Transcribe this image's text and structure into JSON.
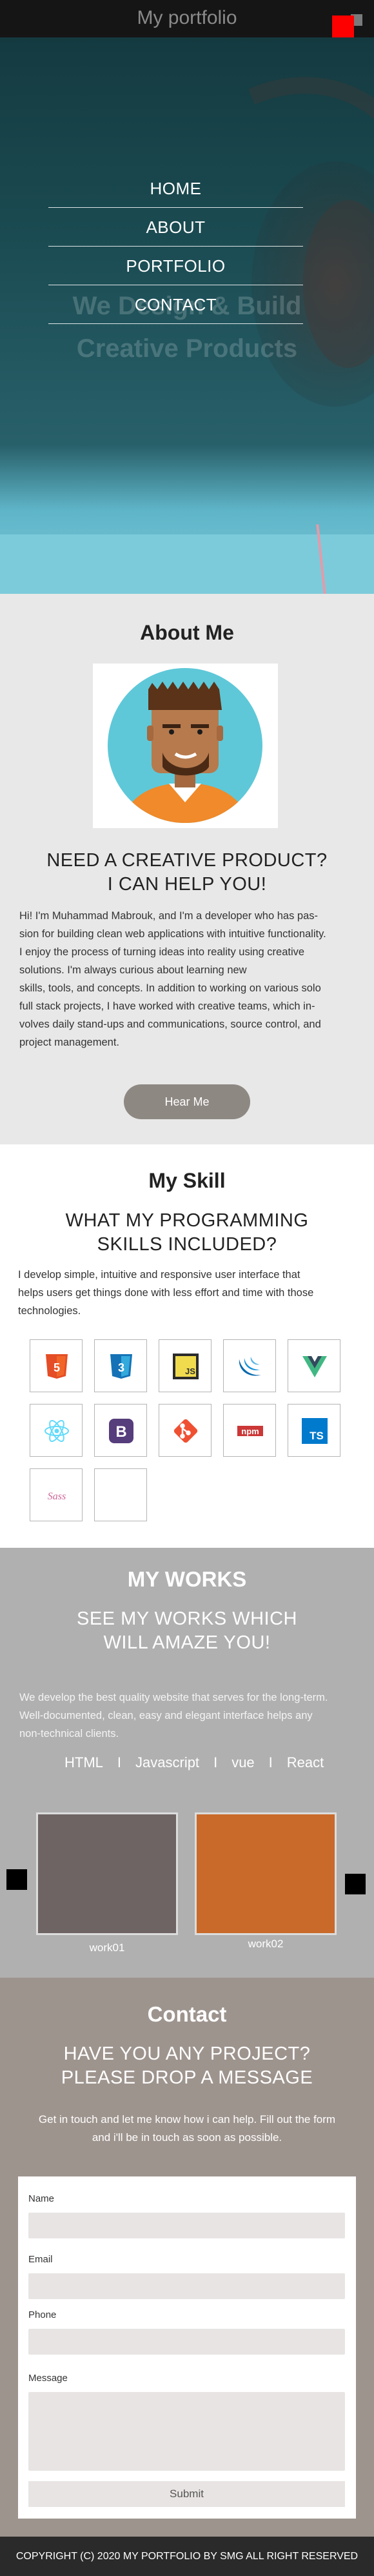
{
  "header": {
    "brand": "My portfolio",
    "nav": [
      {
        "label": "HOME"
      },
      {
        "label": "ABOUT"
      },
      {
        "label": "PORTFOLIO"
      },
      {
        "label": "CONTACT"
      }
    ],
    "hero_line1": "We Design & Build",
    "hero_line2": "Creative Products"
  },
  "about": {
    "title": "About Me",
    "subtitle_line1": "NEED A CREATIVE PRODUCT?",
    "subtitle_line2": "I CAN HELP YOU!",
    "body_lines": [
      "Hi! I'm Muhammad Mabrouk, and I'm a developer who has pas-",
      "sion for building clean web applications with intuitive functionality.",
      "I enjoy the process of turning ideas into reality using creative",
      "solutions. I'm always curious about learning new",
      " skills, tools, and concepts. In addition to working on various solo",
      "full stack projects, I have worked with creative teams, which in-",
      "volves daily stand-ups and communications, source control, and",
      "project management."
    ],
    "button_label": "Hear Me"
  },
  "skills": {
    "title": "My Skill",
    "subtitle_line1": "WHAT MY PROGRAMMING",
    "subtitle_line2": "SKILLS INCLUDED?",
    "body_lines": [
      "I develop simple, intuitive and responsive user interface that",
      "helps users get things done with less effort and time with those",
      "technologies."
    ],
    "icons": [
      {
        "name": "html5-icon",
        "text": "5",
        "color": "#e44d26"
      },
      {
        "name": "css3-icon",
        "text": "3",
        "color": "#1572b6"
      },
      {
        "name": "javascript-icon",
        "text": "JS",
        "color": "#f0db4f"
      },
      {
        "name": "jquery-icon",
        "text": "",
        "color": "#0769ad"
      },
      {
        "name": "vue-icon",
        "text": "",
        "color": "#41b883"
      },
      {
        "name": "react-icon",
        "text": "",
        "color": "#61dafb"
      },
      {
        "name": "bootstrap-icon",
        "text": "B",
        "color": "#563d7c"
      },
      {
        "name": "git-icon",
        "text": "",
        "color": "#f05032"
      },
      {
        "name": "npm-icon",
        "text": "npm",
        "color": "#cb3837"
      },
      {
        "name": "typescript-icon",
        "text": "TS",
        "color": "#007acc"
      },
      {
        "name": "sass-icon",
        "text": "Sass",
        "color": "#cd6799"
      },
      {
        "name": "empty-skill-icon",
        "text": "",
        "color": "#ffffff"
      }
    ]
  },
  "works": {
    "title": "MY WORKS",
    "subtitle_line1": "SEE MY WORKS WHICH",
    "subtitle_line2": "WILL AMAZE YOU!",
    "body_lines": [
      "We develop the best quality website that serves for the long-term.",
      "Well-documented, clean, easy and elegant interface helps any",
      "non-technical clients."
    ],
    "filters": [
      "HTML",
      "Javascript",
      "vue",
      "React"
    ],
    "separator": "I",
    "items": [
      {
        "label": "work01"
      },
      {
        "label": "work02"
      }
    ]
  },
  "contact": {
    "title": "Contact",
    "subtitle_line1": "HAVE YOU ANY PROJECT?",
    "subtitle_line2": "PLEASE DROP A MESSAGE",
    "body_line1": "Get in touch and let me know how i can help. Fill out the form",
    "body_line2": "and i'll be in touch as soon as possible.",
    "form": {
      "name_label": "Name",
      "email_label": "Email",
      "phone_label": "Phone",
      "message_label": "Message",
      "submit_label": "Submit"
    }
  },
  "footer": {
    "text": "COPYRIGHT (C) 2020 MY PORTFOLIO BY SMG ALL RIGHT RESERVED"
  }
}
